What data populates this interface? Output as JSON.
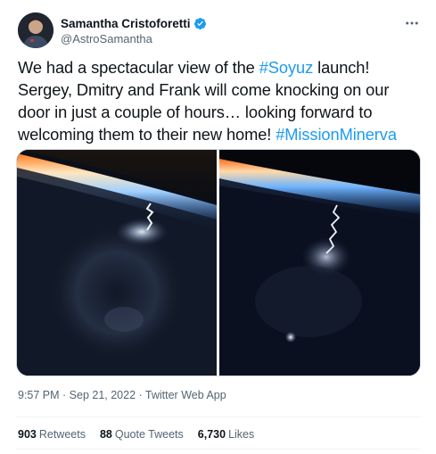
{
  "author": {
    "name": "Samantha Cristoforetti",
    "handle": "@AstroSamantha"
  },
  "tweet": {
    "text_1": "We had a spectacular view of the ",
    "hashtag_1": "#Soyuz",
    "text_2": " launch! Sergey, Dmitry and Frank will come knocking on our door in just a couple of hours… looking forward to welcoming them to their new home! ",
    "hashtag_2": "#MissionMinerva"
  },
  "meta": {
    "timestamp": "9:57 PM · Sep 21, 2022 · Twitter Web App"
  },
  "stats": {
    "retweets_count": "903",
    "retweets_label": "Retweets",
    "quotes_count": "88",
    "quotes_label": "Quote Tweets",
    "likes_count": "6,730",
    "likes_label": "Likes"
  },
  "icons": {
    "verified": "verified-badge-icon",
    "more": "more-options-icon"
  },
  "colors": {
    "accent": "#1d9bf0",
    "text": "#0f1419",
    "muted": "#536471"
  }
}
